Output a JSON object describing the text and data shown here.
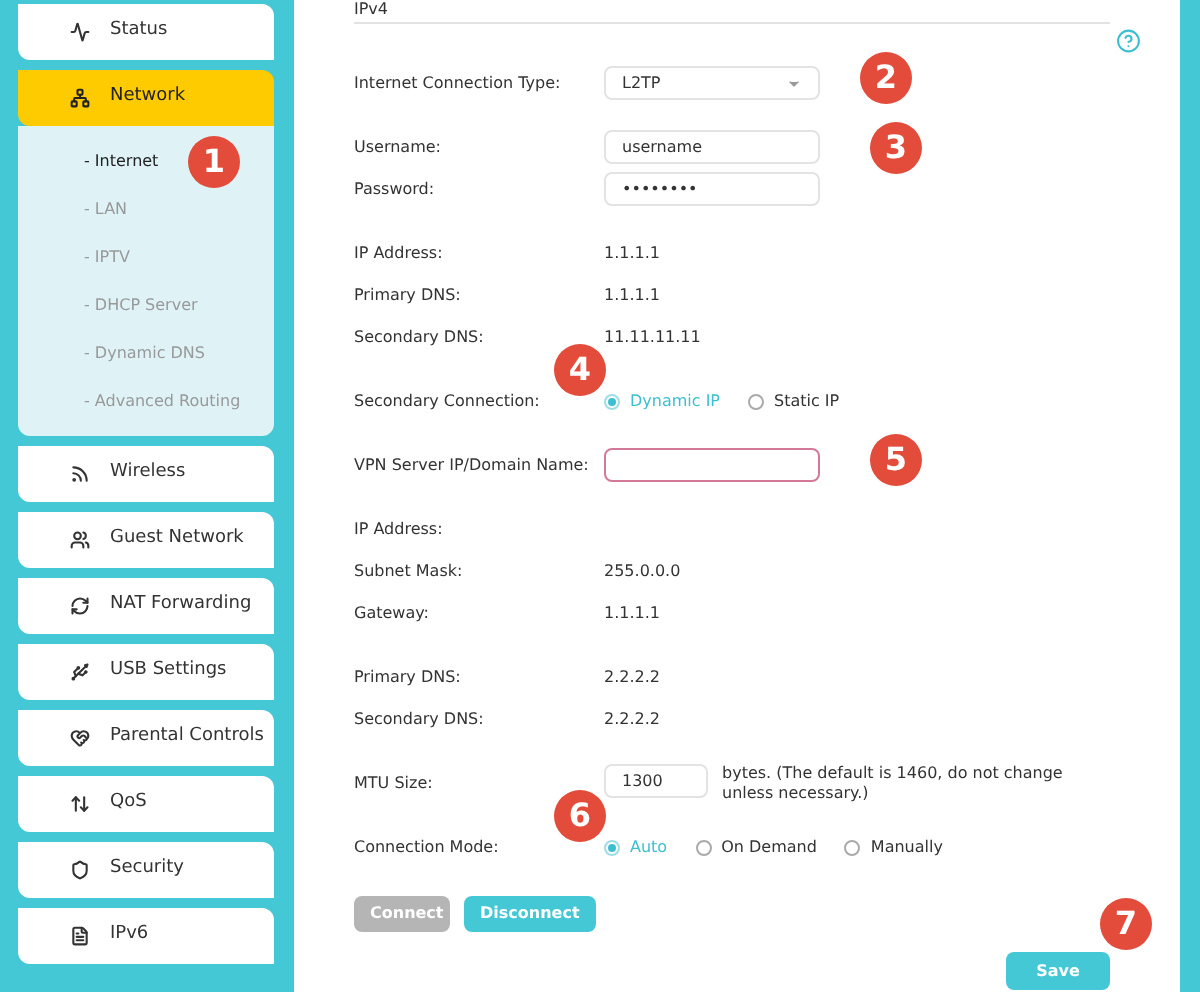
{
  "sidebar": {
    "items": [
      {
        "kind": "status",
        "label": "Status",
        "selected": false
      },
      {
        "kind": "network",
        "label": "Network",
        "selected": true,
        "expanded": true,
        "children": [
          {
            "label": "- Internet",
            "selected": true,
            "marker": "1"
          },
          {
            "label": "- LAN",
            "selected": false
          },
          {
            "label": "- IPTV",
            "selected": false
          },
          {
            "label": "- DHCP Server",
            "selected": false
          },
          {
            "label": "- Dynamic DNS",
            "selected": false
          },
          {
            "label": "- Advanced Routing",
            "selected": false
          }
        ]
      },
      {
        "kind": "wireless",
        "label": "Wireless",
        "selected": false
      },
      {
        "kind": "guest",
        "label": "Guest Network",
        "selected": false
      },
      {
        "kind": "nat",
        "label": "NAT Forwarding",
        "selected": false
      },
      {
        "kind": "usb",
        "label": "USB Settings",
        "selected": false
      },
      {
        "kind": "parental",
        "label": "Parental Controls",
        "selected": false
      },
      {
        "kind": "qos",
        "label": "QoS",
        "selected": false
      },
      {
        "kind": "security",
        "label": "Security",
        "selected": false
      },
      {
        "kind": "ipv6",
        "label": "IPv6",
        "selected": false
      }
    ]
  },
  "panel": {
    "heading": "IPv4",
    "groups": [
      [
        {
          "kind": "select",
          "label": "Internet Connection Type:",
          "value": "L2TP",
          "marker": "2"
        }
      ],
      [
        {
          "kind": "text",
          "label": "Username:",
          "value": "username",
          "marker": "3"
        },
        {
          "kind": "password",
          "label": "Password:",
          "value": "••••••••"
        }
      ],
      [
        {
          "kind": "static",
          "label": "IP Address:",
          "value": "1.1.1.1"
        },
        {
          "kind": "static",
          "label": "Primary DNS:",
          "value": "1.1.1.1"
        },
        {
          "kind": "static",
          "label": "Secondary DNS:",
          "value": "11.11.11.11"
        }
      ],
      [
        {
          "kind": "radio",
          "label": "Secondary Connection:",
          "marker": "4",
          "options": [
            {
              "label": "Dynamic IP",
              "selected": true
            },
            {
              "label": "Static IP",
              "selected": false
            }
          ]
        }
      ],
      [
        {
          "kind": "text",
          "label": "VPN Server IP/Domain Name:",
          "invalid": true,
          "marker": "5"
        }
      ],
      [
        {
          "kind": "static",
          "label": "IP Address:"
        },
        {
          "kind": "static",
          "label": "Subnet Mask:",
          "value": "255.0.0.0"
        },
        {
          "kind": "static",
          "label": "Gateway:",
          "value": "1.1.1.1"
        }
      ],
      [
        {
          "kind": "static",
          "label": "Primary DNS:",
          "value": "2.2.2.2"
        },
        {
          "kind": "static",
          "label": "Secondary DNS:",
          "value": "2.2.2.2"
        }
      ],
      [
        {
          "kind": "mtu",
          "label": "MTU Size:",
          "value": "1300",
          "note": "bytes. (The default is 1460, do not change unless necessary.)"
        }
      ],
      [
        {
          "kind": "radio",
          "label": "Connection Mode:",
          "marker": "6",
          "options": [
            {
              "label": "Auto",
              "selected": true
            },
            {
              "label": "On Demand",
              "selected": false
            },
            {
              "label": "Manually",
              "selected": false
            }
          ]
        }
      ]
    ],
    "buttons": [
      {
        "label": "Connect",
        "disabled": true
      },
      {
        "label": "Disconnect",
        "disabled": false
      }
    ],
    "save": {
      "label": "Save",
      "marker": "7"
    }
  }
}
